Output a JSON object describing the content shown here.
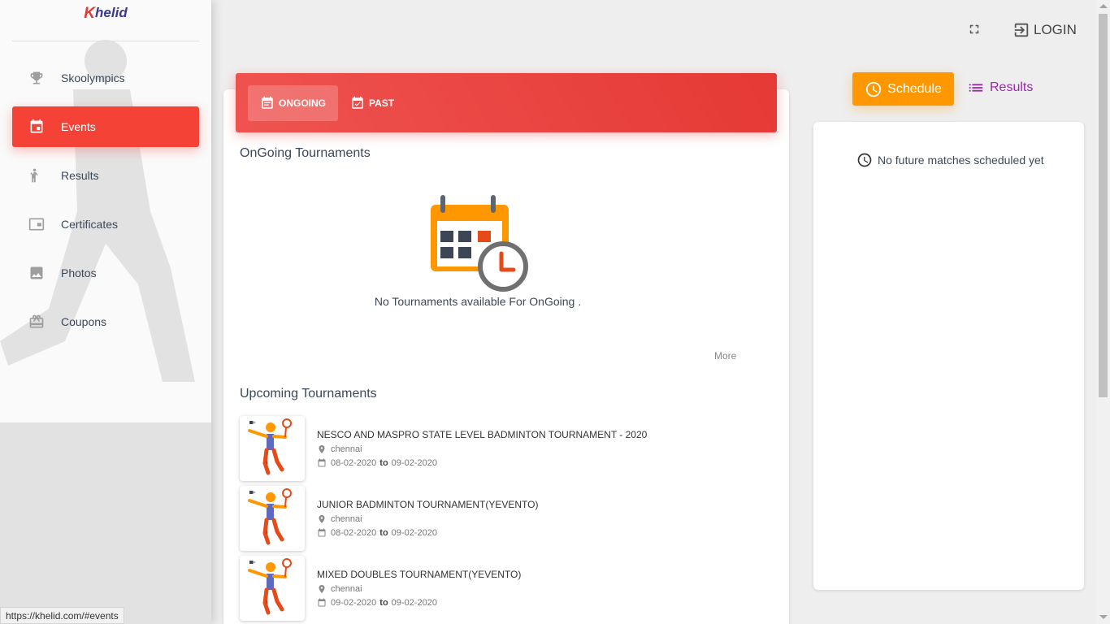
{
  "sidebar": {
    "logo_k": "K",
    "logo_rest": "helid",
    "items": [
      {
        "label": "Skoolympics",
        "icon": "trophy-icon"
      },
      {
        "label": "Events",
        "icon": "calendar-icon"
      },
      {
        "label": "Results",
        "icon": "person-icon"
      },
      {
        "label": "Certificates",
        "icon": "certificate-icon"
      },
      {
        "label": "Photos",
        "icon": "photo-icon"
      },
      {
        "label": "Coupons",
        "icon": "gift-icon"
      }
    ]
  },
  "header": {
    "login_label": "LOGIN"
  },
  "tabs": {
    "ongoing": "ONGOING",
    "past": "PAST"
  },
  "ongoing": {
    "title": "OnGoing Tournaments",
    "empty_text": "No Tournaments available For OnGoing .",
    "more": "More"
  },
  "upcoming": {
    "title": "Upcoming Tournaments",
    "to_word": "to",
    "items": [
      {
        "name": "NESCO AND MASPRO STATE LEVEL BADMINTON TOURNAMENT - 2020",
        "location": "chennai",
        "start": "08-02-2020",
        "end": "09-02-2020"
      },
      {
        "name": "JUNIOR BADMINTON TOURNAMENT(YEVENTO)",
        "location": "chennai",
        "start": "08-02-2020",
        "end": "09-02-2020"
      },
      {
        "name": "MIXED DOUBLES TOURNAMENT(YEVENTO)",
        "location": "chennai",
        "start": "09-02-2020",
        "end": "09-02-2020"
      }
    ]
  },
  "right": {
    "schedule_label": "Schedule",
    "results_label": "Results",
    "no_matches": "No future matches scheduled yet"
  },
  "status_bar": {
    "url": "https://khelid.com/#events"
  },
  "colors": {
    "accent_red": "#f44336",
    "schedule_orange": "#ff9800",
    "results_purple": "#9c27b0"
  }
}
